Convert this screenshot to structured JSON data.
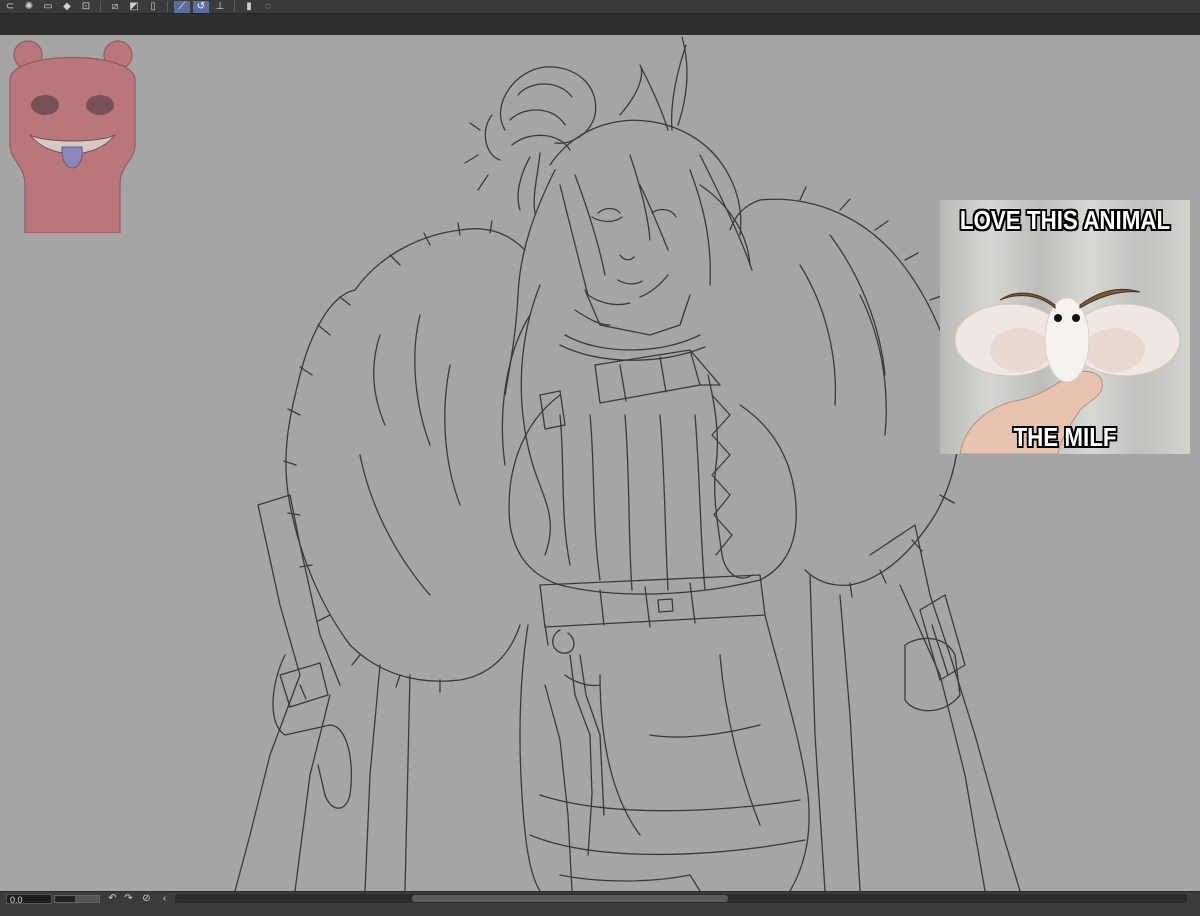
{
  "toolbar": {
    "tools": [
      {
        "name": "lasso-tool-icon",
        "glyph": "⊂"
      },
      {
        "name": "loading-spinner-icon",
        "glyph": "✺"
      },
      {
        "name": "selection-layer-icon",
        "glyph": "▭"
      },
      {
        "name": "eraser-icon",
        "glyph": "◆"
      },
      {
        "name": "transform-icon",
        "glyph": "⊡"
      },
      {
        "name": "crop-icon",
        "glyph": "⧄"
      },
      {
        "name": "fill-icon",
        "glyph": "◩"
      },
      {
        "name": "blank-layer-icon",
        "glyph": "▯"
      },
      {
        "name": "ruler-icon",
        "glyph": "⟋"
      },
      {
        "name": "perspective-ruler-icon",
        "glyph": "↺"
      },
      {
        "name": "ruler-grid-icon",
        "glyph": "⊥"
      },
      {
        "name": "phone-preview-icon",
        "glyph": "▮"
      },
      {
        "name": "speech-bubble-icon",
        "glyph": "◌"
      }
    ],
    "active_tools": [
      8,
      9
    ]
  },
  "meme": {
    "top_text": "LOVE THIS ANIMAL",
    "bottom_text": "THE MILF"
  },
  "statusbar": {
    "zoom_value": "0.0",
    "zoom_fraction": 0.45,
    "scroll_thumb": {
      "start": 0.234,
      "end": 0.546
    },
    "buttons": [
      {
        "name": "rotate-left-icon",
        "glyph": "↶"
      },
      {
        "name": "rotate-right-icon",
        "glyph": "↷"
      },
      {
        "name": "reset-rotation-icon",
        "glyph": "⊘"
      },
      {
        "name": "flip-icon",
        "glyph": "‹"
      }
    ]
  },
  "colors": {
    "canvas": "#a5a5a5",
    "lineart": "#3a3a3a",
    "toolbar": "#3a3a3a",
    "active_tool": "#5a6f9c",
    "watermark": "#c75a60"
  }
}
